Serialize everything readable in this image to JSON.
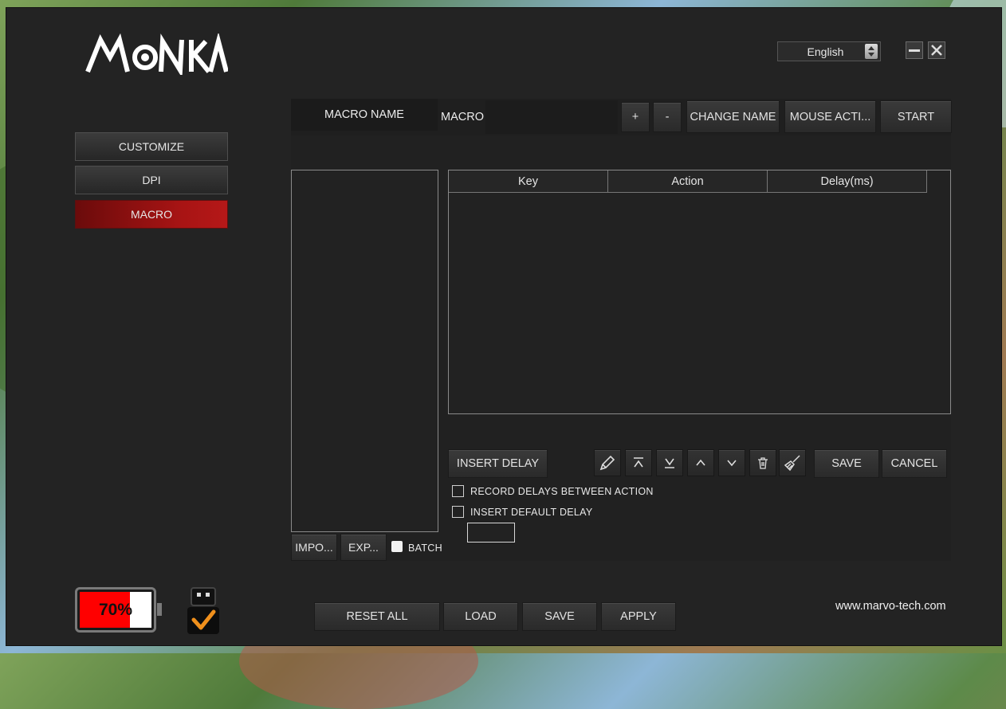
{
  "app": {
    "logo_text": "MONKA",
    "website": "www.marvo-tech.com"
  },
  "language": {
    "selected": "English"
  },
  "window": {
    "minimize_icon": "minus-icon",
    "close_icon": "close-icon"
  },
  "nav": {
    "items": [
      {
        "label": "CUSTOMIZE",
        "active": false
      },
      {
        "label": "DPI",
        "active": false
      },
      {
        "label": "MACRO",
        "active": true
      }
    ]
  },
  "macro_bar": {
    "macro_name_label": "MACRO NAME",
    "macro_label": "MACRO",
    "macro_value": "",
    "add_label": "+",
    "remove_label": "-",
    "change_name_label": "CHANGE NAME",
    "mouse_action_label": "MOUSE ACTI...",
    "start_label": "START"
  },
  "macro_list": {
    "import_label": "IMPO...",
    "export_label": "EXP...",
    "batch_label": "BATCH"
  },
  "event_table": {
    "columns": [
      "Key",
      "Action",
      "Delay(ms)"
    ],
    "rows": []
  },
  "editor": {
    "insert_delay_label": "INSERT DELAY",
    "tools": [
      "pencil-icon",
      "move-top-icon",
      "move-bottom-icon",
      "move-up-icon",
      "move-down-icon",
      "trash-icon",
      "brush-icon"
    ],
    "save_label": "SAVE",
    "cancel_label": "CANCEL",
    "record_delays_label": "RECORD DELAYS BETWEEN ACTION",
    "insert_default_delay_label": "INSERT DEFAULT DELAY",
    "default_delay_value": ""
  },
  "footer": {
    "battery_text": "70%",
    "battery_level": 0.7,
    "colors": {
      "battery_fill": "#ff0000",
      "check": "#f0901c",
      "active_nav": "#a81414"
    },
    "reset_all_label": "RESET ALL",
    "load_label": "LOAD",
    "save_label": "SAVE",
    "apply_label": "APPLY"
  }
}
